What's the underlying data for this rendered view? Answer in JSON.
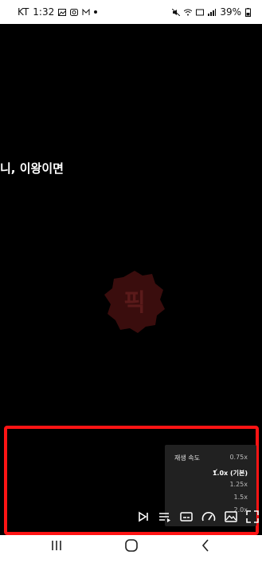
{
  "status_bar": {
    "carrier": "KT",
    "time": "1:32",
    "battery": "39%"
  },
  "video": {
    "subtitle": "니, 이왕이면",
    "watermark_text": "픽"
  },
  "speed_menu": {
    "title": "재생 속도",
    "options": [
      "0.75x",
      "1.0x (기본)",
      "1.25x",
      "1.5x",
      "2.0x"
    ],
    "selected_index": 1
  },
  "controls": [
    "next-icon",
    "playlist-icon",
    "subtitles-icon",
    "speed-icon",
    "picture-icon",
    "fullscreen-icon"
  ],
  "colors": {
    "highlight": "#ff1414",
    "menu_bg": "#212121"
  }
}
